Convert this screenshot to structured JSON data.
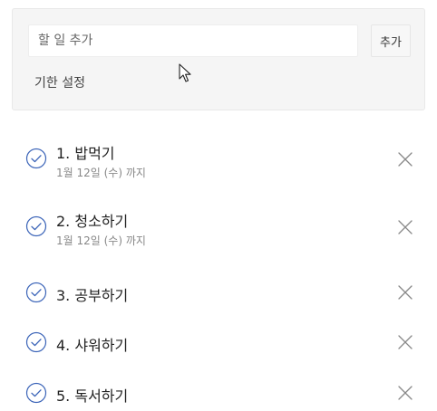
{
  "add_form": {
    "input_placeholder": "할 일 추가",
    "input_value": "",
    "add_button_label": "추가",
    "deadline_label": "기한 설정"
  },
  "todos": [
    {
      "text": "1. 밥먹기",
      "deadline": "1월 12일 (수) 까지"
    },
    {
      "text": "2. 청소하기",
      "deadline": "1월 12일 (수) 까지"
    },
    {
      "text": "3. 공부하기"
    },
    {
      "text": "4. 샤워하기"
    },
    {
      "text": "5. 독서하기"
    }
  ],
  "icons": {
    "check": "check-circle-icon",
    "delete": "close-icon",
    "cursor": "mouse-pointer-icon"
  },
  "colors": {
    "check_icon": "#3b64b8",
    "delete_icon": "#888888",
    "panel_background": "#f5f5f5",
    "deadline_text": "#888888"
  }
}
